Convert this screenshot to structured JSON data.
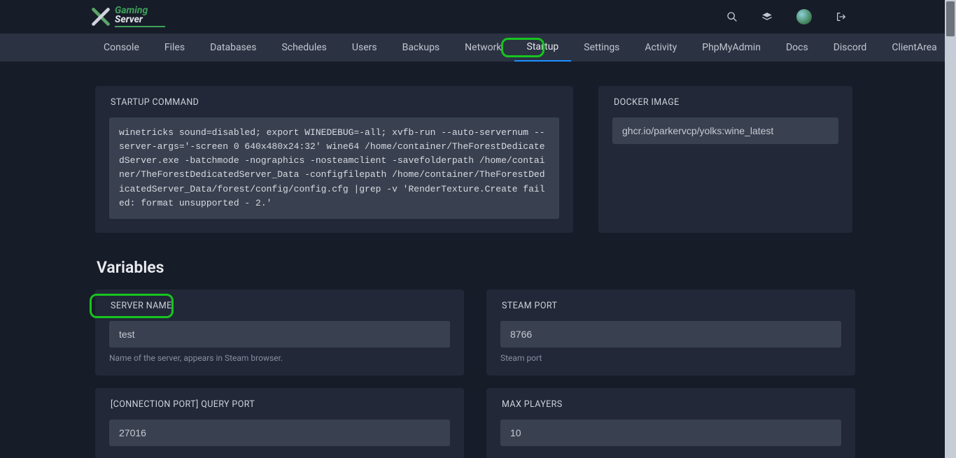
{
  "brand": {
    "top": "Gaming",
    "bot": "Server"
  },
  "nav": {
    "items": [
      "Console",
      "Files",
      "Databases",
      "Schedules",
      "Users",
      "Backups",
      "Network",
      "Startup",
      "Settings",
      "Activity",
      "PhpMyAdmin",
      "Docs",
      "Discord",
      "ClientArea"
    ],
    "active_index": 7
  },
  "startup": {
    "title": "STARTUP COMMAND",
    "command": "winetricks sound=disabled; export WINEDEBUG=-all; xvfb-run --auto-servernum --server-args='-screen 0 640x480x24:32' wine64 /home/container/TheForestDedicatedServer.exe -batchmode -nographics -nosteamclient -savefolderpath /home/container/TheForestDedicatedServer_Data -configfilepath /home/container/TheForestDedicatedServer_Data/forest/config/config.cfg |grep -v 'RenderTexture.Create failed: format unsupported - 2.'"
  },
  "docker": {
    "title": "DOCKER IMAGE",
    "image": "ghcr.io/parkervcp/yolks:wine_latest"
  },
  "variables_heading": "Variables",
  "variables": [
    {
      "title": "SERVER NAME",
      "value": "test",
      "help": "Name of the server, appears in Steam browser."
    },
    {
      "title": "STEAM PORT",
      "value": "8766",
      "help": "Steam port"
    },
    {
      "title": "[CONNECTION PORT] QUERY PORT",
      "value": "27016",
      "help": ""
    },
    {
      "title": "MAX PLAYERS",
      "value": "10",
      "help": ""
    }
  ],
  "highlights": {
    "startup_tab": true,
    "server_name": true
  }
}
